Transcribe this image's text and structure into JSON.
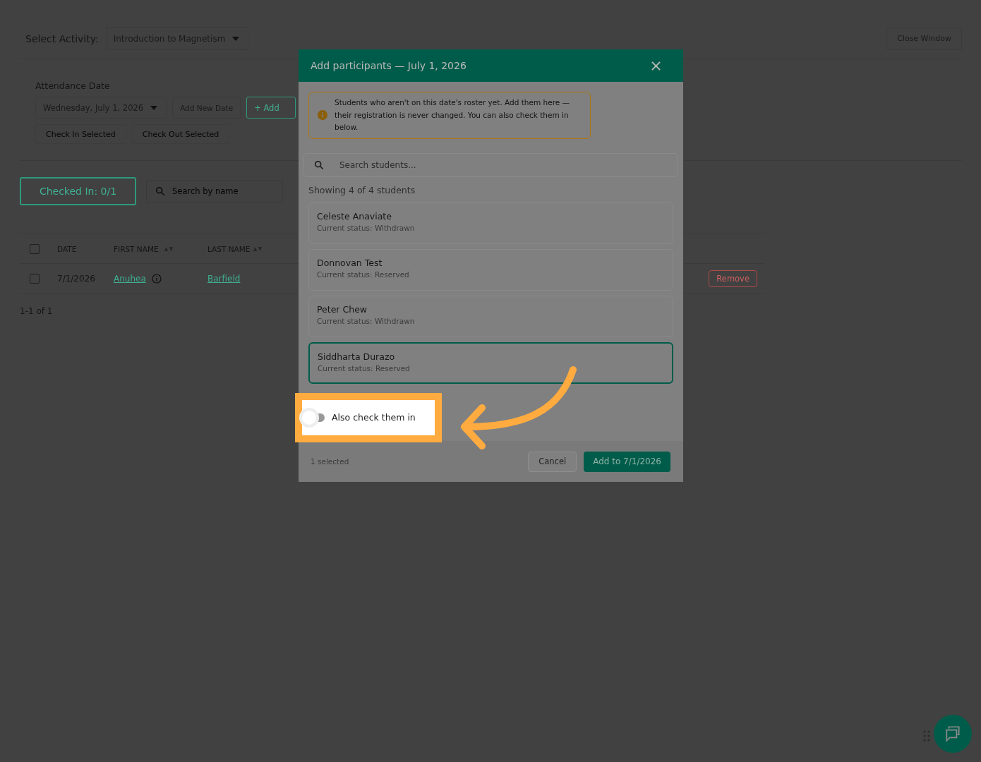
{
  "page": {
    "activity_label": "Select Activity:",
    "activity_value": "Introduction to Magnetism",
    "close_button": "Close Window",
    "attendance_label": "Attendance Date",
    "date_value": "Wednesday, July 1, 2026",
    "add_date_button": "Add New Date",
    "add_button": "+ Add",
    "bulk_buttons": [
      {
        "label": "Check In Selected",
        "disabled": true
      },
      {
        "label": "Check Out Selected",
        "disabled": true
      }
    ],
    "checked_in": "Checked In: 0/1",
    "search_placeholder": "Search by name",
    "table": {
      "select_all_checked": false,
      "columns": [
        {
          "label": "DATE",
          "sortable": false
        },
        {
          "label": "FIRST NAME",
          "sortable": true
        },
        {
          "label": "LAST NAME",
          "sortable": true
        }
      ],
      "rows": [
        {
          "checked": false,
          "date": "7/1/2026",
          "first_name": "Anuhea",
          "last_name": "Barfield",
          "action": "Remove"
        }
      ]
    },
    "pagination": "1-1 of 1"
  },
  "dialog": {
    "title": "Add participants — July 1, 2026",
    "notice": "Students who aren't on this date's roster yet. Add them here — their registration is never changed. You can also check them in below.",
    "search_placeholder": "Search students...",
    "count": "Showing 4 of 4 students",
    "students": [
      {
        "name": "Celeste Anaviate",
        "status": "Current status: Withdrawn",
        "selected": false
      },
      {
        "name": "Donnovan Test",
        "status": "Current status: Reserved",
        "selected": false
      },
      {
        "name": "Peter Chew",
        "status": "Current status: Withdrawn",
        "selected": false
      },
      {
        "name": "Siddharta Durazo",
        "status": "Current status: Reserved",
        "selected": true
      }
    ],
    "toggle": {
      "label": "Also check them in",
      "on": false
    },
    "footer_status": "1 selected",
    "cancel": "Cancel",
    "confirm": "Add to 7/1/2026"
  }
}
